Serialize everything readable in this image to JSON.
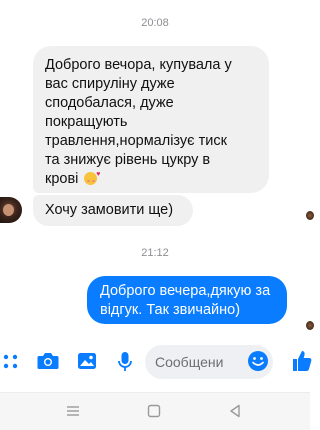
{
  "conversation": {
    "timestamps": [
      "20:08",
      "21:12"
    ],
    "incoming": [
      {
        "lines": [
          "Доброго вечора, купувала у",
          "вас спиpуліну дуже",
          "сподобалася, дуже",
          "покращують",
          "травлення,нормалізує тиск",
          "та знижує рівень цукру в",
          "крові"
        ],
        "emoji": "smiling-face-with-hearts-emoji"
      },
      {
        "text": "Хочу замовити ще)"
      }
    ],
    "outgoing": [
      {
        "lines": [
          "Доброго вечера,дякую за",
          "відгук. Так звичайно)"
        ]
      }
    ]
  },
  "composer": {
    "placeholder": "Сообщени",
    "icons": [
      "more-icon",
      "camera-icon",
      "gallery-icon",
      "mic-icon",
      "emoji-icon",
      "like-icon"
    ]
  },
  "colors": {
    "accent": "#0a7cff",
    "incoming_bubble": "#f0f0f0",
    "timestamp": "#8e8e93"
  },
  "system_nav": {
    "buttons": [
      "menu-button",
      "home-button",
      "back-button"
    ]
  }
}
